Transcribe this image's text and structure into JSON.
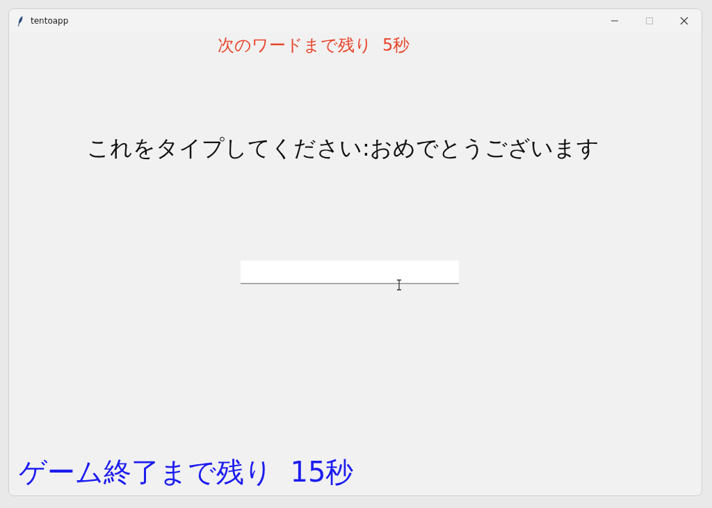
{
  "window": {
    "title": "tentoapp"
  },
  "next_word_timer": "次のワードまで残り  5秒",
  "prompt": "これをタイプしてください:おめでとうございます",
  "game_timer": "ゲーム終了まで残り  15秒"
}
